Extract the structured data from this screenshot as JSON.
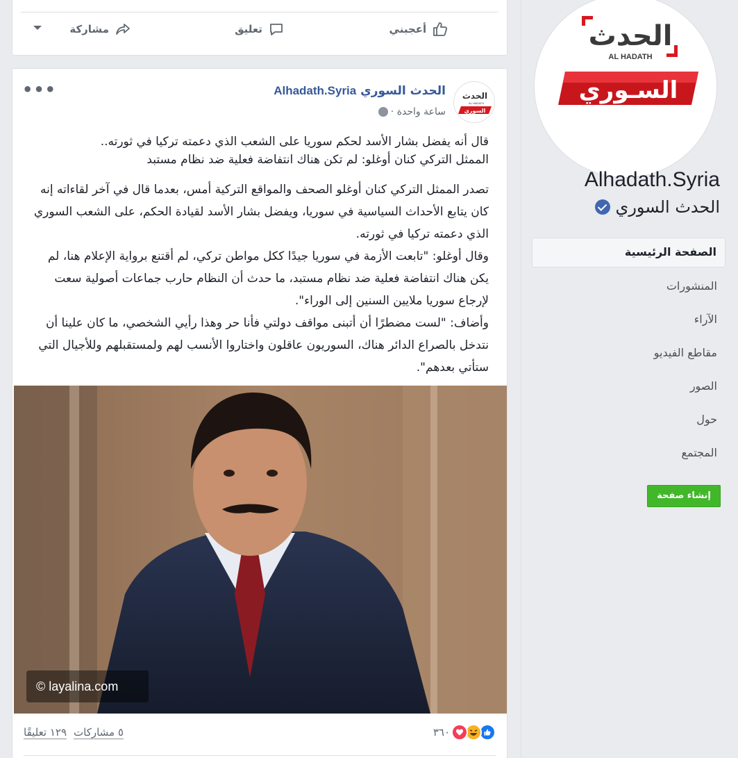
{
  "sidebar": {
    "logo": {
      "top_text": "الحدث",
      "en_text": "AL HADATH",
      "bottom_text": "السـوري"
    },
    "page_name": "Alhadath.Syria",
    "page_name_ar": "الحدث السوري",
    "nav_items": [
      {
        "label": "الصفحة الرئيسية",
        "active": true
      },
      {
        "label": "المنشورات"
      },
      {
        "label": "الآراء"
      },
      {
        "label": "مقاطع الفيديو"
      },
      {
        "label": "الصور"
      },
      {
        "label": "حول"
      },
      {
        "label": "المجتمع"
      }
    ],
    "create_page": "إنشاء صفحة"
  },
  "top_card": {
    "like": "أعجبني",
    "comment": "تعليق",
    "share": "مشاركة"
  },
  "post": {
    "avatar": {
      "top_text": "الحدث",
      "en_text": "AL HADATH",
      "bottom_text": "السوري"
    },
    "author_ar": "الحدث السوري",
    "author_en": "Alhadath.Syria",
    "time": "ساعة واحدة ·",
    "more": "•••",
    "intro_line1": "قال أنه يفضل بشار الأسد لحكم سوريا على الشعب الذي دعمته تركيا في ثورته..",
    "intro_line2": "الممثل التركي كنان أوغلو: لم تكن هناك انتفاضة فعلية ضد نظام مستبد",
    "paragraph1": "تصدر الممثل التركي كنان أوغلو الصحف والمواقع التركية أمس، بعدما قال في آخر لقاءاته إنه كان يتابع الأحداث السياسية في سوريا، ويفضل بشار الأسد لقيادة الحكم، على الشعب السوري الذي دعمته تركيا في ثورته.",
    "paragraph2": "وقال أوغلو: \"تابعت الأزمة في سوريا جيدًا ككل مواطن تركي، لم أقتنع برواية الإعلام هنا، لم يكن هناك انتفاضة فعلية ضد نظام مستبد، ما حدث أن النظام حارب جماعات أصولية سعت لإرجاع سوريا ملايين السنين إلى الوراء\".",
    "paragraph3": "وأضاف: \"لست مضطرًا أن أتبنى مواقف دولتي فأنا حر وهذا رأيي الشخصي، ما كان علينا أن نتدخل بالصراع الدائر هناك، السوريون عاقلون واختاروا الأنسب لهم ولمستقبلهم وللأجيال التي ستأتي بعدهم\".",
    "watermark": "© layalina.com",
    "reactions_count": "٣٦٠",
    "comments_count": "١٢٩ تعليقًا",
    "shares_count": "٥ مشاركات"
  },
  "colors": {
    "fb_blue": "#365899",
    "create_green": "#42b72a",
    "logo_red": "#d71920"
  }
}
